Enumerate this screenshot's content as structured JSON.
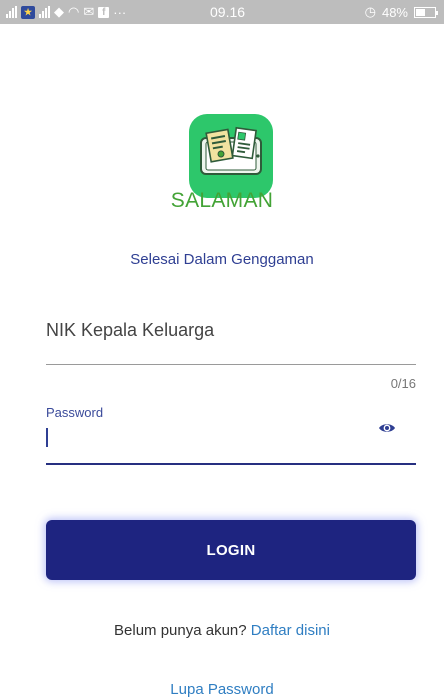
{
  "status_bar": {
    "time": "09.16",
    "battery_text": "48%",
    "carrier_badge": "★",
    "icons": [
      "signal-icon",
      "sim-icon",
      "signal-icon",
      "location-icon",
      "wifi-icon",
      "notification-icon",
      "facebook-icon",
      "more-icon",
      "alarm-icon",
      "battery-icon"
    ]
  },
  "app": {
    "name": "SALAMAN",
    "tagline": "Selesai Dalam Genggaman",
    "icon": "phone-documents-icon",
    "brand_color": "#2dc76b",
    "title_color": "#43a336"
  },
  "form": {
    "nik_label": "NIK Kepala Keluarga",
    "nik_counter": "0/16",
    "password_label": "Password",
    "password_value": "",
    "toggle_icon": "eye-icon",
    "login_label": "LOGIN",
    "login_color": "#1e2480"
  },
  "footer": {
    "signup_prompt": "Belum punya akun?",
    "signup_link": "Daftar disini",
    "forgot_password": "Lupa Password",
    "link_color": "#2f7ec2"
  }
}
